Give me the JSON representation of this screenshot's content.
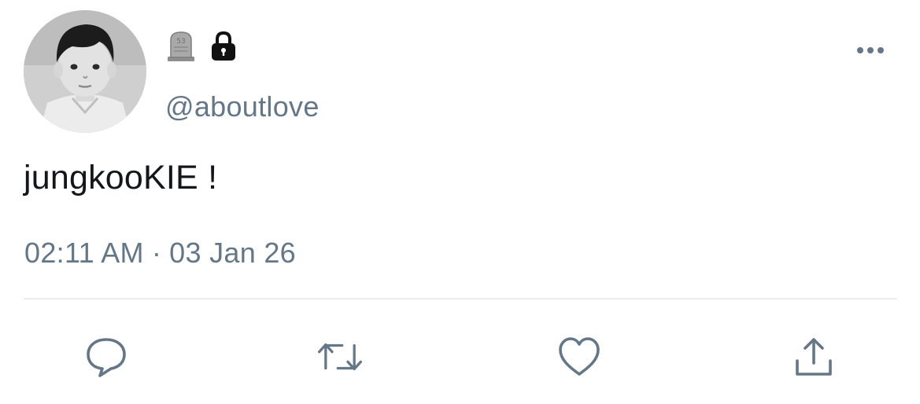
{
  "tweet": {
    "handle": "@aboutlove",
    "badges": [
      "headstone-emoji",
      "lock-emoji"
    ],
    "text": "jungkooKIE !",
    "time": "02:11 AM",
    "separator": "·",
    "date": "03 Jan 26"
  },
  "actions": [
    {
      "icon": "reply-icon"
    },
    {
      "icon": "retweet-icon"
    },
    {
      "icon": "like-icon"
    },
    {
      "icon": "share-icon"
    }
  ],
  "colors": {
    "text_primary": "#14171a",
    "text_secondary": "#657786",
    "icon_gray": "#657786",
    "divider": "#e6ecf0"
  }
}
